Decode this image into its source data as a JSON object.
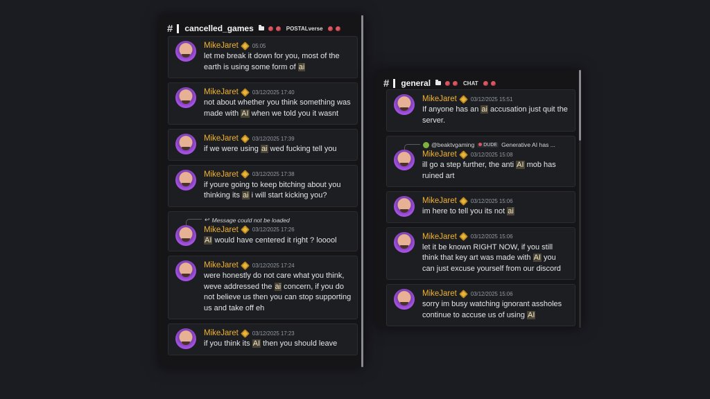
{
  "left": {
    "hash": "#",
    "channel_name": "cancelled_games",
    "channel_sub": "POSTALverse",
    "messages": [
      {
        "user": "MikeJaret",
        "time": "05:05",
        "parts": [
          [
            "let me break it down for you, most of the earth is using some form of ",
            false
          ],
          [
            "ai",
            true
          ]
        ]
      },
      {
        "user": "MikeJaret",
        "time": "03/12/2025 17:40",
        "parts": [
          [
            "not about whether you think something was made with ",
            false
          ],
          [
            "AI",
            true
          ],
          [
            " when we told you it wasnt",
            false
          ]
        ]
      },
      {
        "user": "MikeJaret",
        "time": "03/12/2025 17:39",
        "parts": [
          [
            "if we were using ",
            false
          ],
          [
            "ai",
            true
          ],
          [
            " wed fucking tell you",
            false
          ]
        ]
      },
      {
        "user": "MikeJaret",
        "time": "03/12/2025 17:38",
        "parts": [
          [
            "if youre going to keep bitching about you thinking its ",
            false
          ],
          [
            "ai",
            true
          ],
          [
            " i will start kicking you?",
            false
          ]
        ]
      },
      {
        "user": "MikeJaret",
        "time": "03/12/2025 17:26",
        "reply": {
          "arrow": "↩",
          "text": "Message could not be loaded"
        },
        "parts": [
          [
            "AI",
            true
          ],
          [
            " would have centered it right ? looool",
            false
          ]
        ]
      },
      {
        "user": "MikeJaret",
        "time": "03/12/2025 17:24",
        "parts": [
          [
            "were honestly do not care what you think, weve addressed the ",
            false
          ],
          [
            "ai",
            true
          ],
          [
            " concern, if you do not believe us then you can stop supporting us and take off eh",
            false
          ]
        ]
      },
      {
        "user": "MikeJaret",
        "time": "03/12/2025 17:23",
        "parts": [
          [
            "if you think its ",
            false
          ],
          [
            "AI",
            true
          ],
          [
            " then you should leave",
            false
          ]
        ]
      }
    ]
  },
  "right": {
    "hash": "#",
    "channel_name": "general",
    "channel_sub": "CHAT",
    "messages": [
      {
        "user": "MikeJaret",
        "time": "03/12/2025 15:51",
        "parts": [
          [
            "If anyone has an ",
            false
          ],
          [
            "ai",
            true
          ],
          [
            " accusation just quit the server.",
            false
          ]
        ]
      },
      {
        "user": "MikeJaret",
        "time": "03/12/2025 15:08",
        "reply": {
          "user": "@beaktvgaming",
          "tag": "DUDE",
          "preview": "Generative AI has ..."
        },
        "parts": [
          [
            "ill go a step further, the anti ",
            false
          ],
          [
            "AI",
            true
          ],
          [
            " mob has ruined art",
            false
          ]
        ]
      },
      {
        "user": "MikeJaret",
        "time": "03/12/2025 15:06",
        "parts": [
          [
            "im here to tell you its not ",
            false
          ],
          [
            "ai",
            true
          ]
        ]
      },
      {
        "user": "MikeJaret",
        "time": "03/12/2025 15:06",
        "parts": [
          [
            "let it be known RIGHT NOW, if you still think that key art was made with ",
            false
          ],
          [
            "AI",
            true
          ],
          [
            " you can just excuse yourself from our discord",
            false
          ]
        ]
      },
      {
        "user": "MikeJaret",
        "time": "03/12/2025 15:06",
        "parts": [
          [
            "sorry im busy watching ignorant assholes continue to accuse us of using ",
            false
          ],
          [
            "AI",
            true
          ]
        ]
      }
    ]
  },
  "colors": {
    "username": "#f0b232",
    "highlight_bg": "#4a4536",
    "background": "#1b1b22",
    "panel": "#151518"
  },
  "icons": [
    "hash-icon",
    "folder-icon",
    "red-dot-icon",
    "verified-badge-icon",
    "reply-arrow-icon"
  ]
}
